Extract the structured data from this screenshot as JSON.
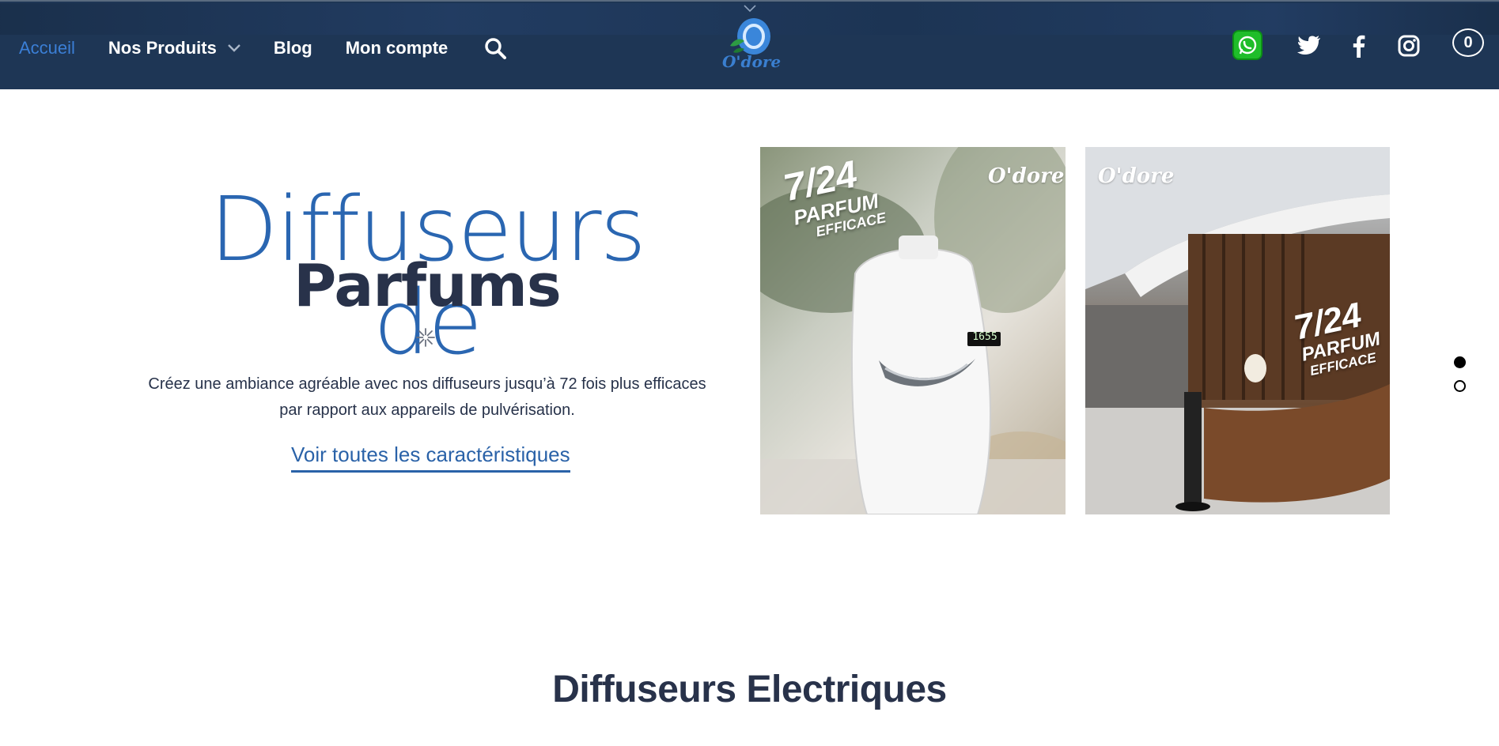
{
  "header": {
    "nav": {
      "home": "Accueil",
      "products": "Nos Produits",
      "blog": "Blog",
      "account": "Mon compte"
    },
    "logo_text": "O'dore",
    "cart_count": "0",
    "icons": [
      "search-icon",
      "whatsapp-icon",
      "twitter-icon",
      "facebook-icon",
      "instagram-icon"
    ]
  },
  "hero": {
    "title_line1": "Diffuseurs de",
    "title_line2": "Parfums",
    "description_line1": "Créez une ambiance agréable avec nos diffuseurs jusqu’à 72 fois plus efficaces",
    "description_line2": "par rapport aux appareils de pulvérisation.",
    "link": "Voir toutes les caractéristiques"
  },
  "slides": [
    {
      "badge_top": "7/24",
      "badge_mid": "PARFUM",
      "badge_bottom": "EFFICACE",
      "brand": "O'dore",
      "display": "1655"
    },
    {
      "badge_top": "7/24",
      "badge_mid": "PARFUM",
      "badge_bottom": "EFFICACE",
      "brand": "O'dore"
    }
  ],
  "pager": {
    "total": 2,
    "active": 1
  },
  "section": {
    "title": "Diffuseurs Electriques"
  },
  "colors": {
    "header_bg": "#1e3655",
    "accent": "#2a66b1",
    "text_dark": "#28324a",
    "whatsapp": "#1fbd2a"
  }
}
